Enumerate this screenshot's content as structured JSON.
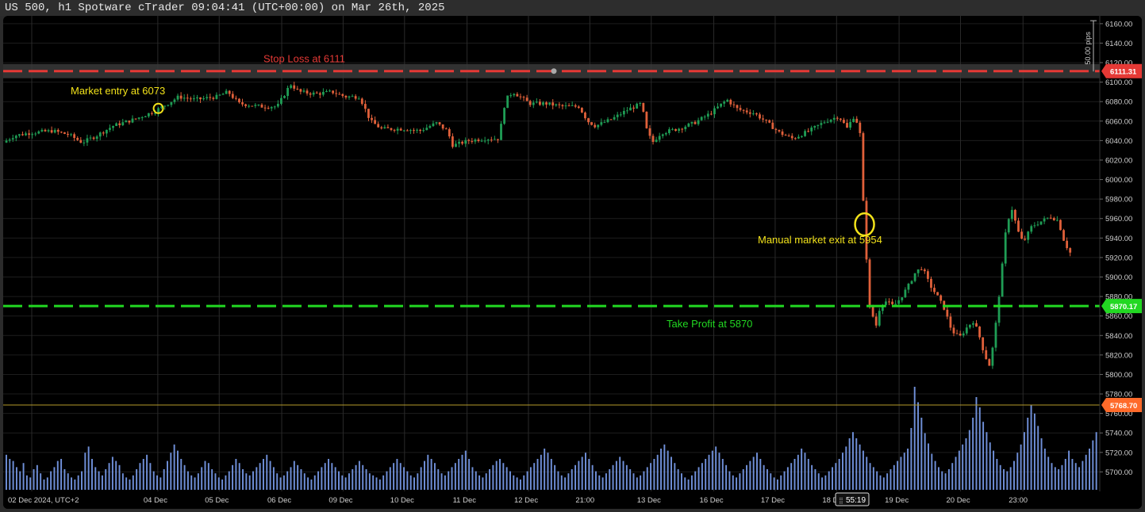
{
  "window": {
    "title": "US 500, h1 Spotware cTrader 09:04:41 (UTC+00:00) on Mar 26th, 2025"
  },
  "chart_data": {
    "type": "candlestick",
    "symbol": "US 500",
    "timeframe": "h1",
    "broker": "Spotware cTrader",
    "ylim": [
      5680,
      6168
    ],
    "y_ticks": [
      "6160.00",
      "6140.00",
      "6120.00",
      "6100.00",
      "6080.00",
      "6060.00",
      "6040.00",
      "6020.00",
      "6000.00",
      "5980.00",
      "5960.00",
      "5940.00",
      "5920.00",
      "5900.00",
      "5880.00",
      "5860.00",
      "5840.00",
      "5820.00",
      "5800.00",
      "5780.00",
      "5760.00",
      "5740.00",
      "5720.00",
      "5700.00"
    ],
    "x_labels": [
      {
        "label": "02 Dec 2024, UTC+2",
        "t": 0.0
      },
      {
        "label": "04 Dec",
        "t": 0.141
      },
      {
        "label": "05 Dec",
        "t": 0.197
      },
      {
        "label": "06 Dec",
        "t": 0.254
      },
      {
        "label": "09 Dec",
        "t": 0.31
      },
      {
        "label": "10 Dec",
        "t": 0.366
      },
      {
        "label": "11 Dec",
        "t": 0.423
      },
      {
        "label": "12 Dec",
        "t": 0.479
      },
      {
        "label": "21:00",
        "t": 0.535
      },
      {
        "label": "13 Dec",
        "t": 0.591
      },
      {
        "label": "16 Dec",
        "t": 0.648
      },
      {
        "label": "17 Dec",
        "t": 0.704
      },
      {
        "label": "18 Dec",
        "t": 0.76
      },
      {
        "label": "19 Dec",
        "t": 0.817
      },
      {
        "label": "20 Dec",
        "t": 0.873
      },
      {
        "label": "23:00",
        "t": 0.93
      }
    ],
    "time_badge": "55:19",
    "pips_label": "50.00 pips",
    "price_path": [
      [
        0.0,
        6038
      ],
      [
        0.01,
        6045
      ],
      [
        0.025,
        6048
      ],
      [
        0.045,
        6050
      ],
      [
        0.06,
        6046
      ],
      [
        0.072,
        6038
      ],
      [
        0.085,
        6045
      ],
      [
        0.1,
        6055
      ],
      [
        0.12,
        6062
      ],
      [
        0.138,
        6070
      ],
      [
        0.15,
        6078
      ],
      [
        0.16,
        6085
      ],
      [
        0.175,
        6082
      ],
      [
        0.195,
        6085
      ],
      [
        0.205,
        6090
      ],
      [
        0.215,
        6078
      ],
      [
        0.235,
        6075
      ],
      [
        0.25,
        6075
      ],
      [
        0.262,
        6098
      ],
      [
        0.27,
        6090
      ],
      [
        0.285,
        6088
      ],
      [
        0.3,
        6090
      ],
      [
        0.312,
        6085
      ],
      [
        0.325,
        6085
      ],
      [
        0.335,
        6060
      ],
      [
        0.345,
        6052
      ],
      [
        0.365,
        6052
      ],
      [
        0.38,
        6050
      ],
      [
        0.395,
        6058
      ],
      [
        0.405,
        6050
      ],
      [
        0.41,
        6035
      ],
      [
        0.425,
        6040
      ],
      [
        0.44,
        6042
      ],
      [
        0.452,
        6042
      ],
      [
        0.458,
        6082
      ],
      [
        0.465,
        6090
      ],
      [
        0.48,
        6078
      ],
      [
        0.495,
        6078
      ],
      [
        0.51,
        6075
      ],
      [
        0.525,
        6075
      ],
      [
        0.533,
        6060
      ],
      [
        0.54,
        6055
      ],
      [
        0.555,
        6062
      ],
      [
        0.57,
        6072
      ],
      [
        0.582,
        6078
      ],
      [
        0.587,
        6050
      ],
      [
        0.592,
        6038
      ],
      [
        0.6,
        6048
      ],
      [
        0.615,
        6052
      ],
      [
        0.63,
        6058
      ],
      [
        0.645,
        6068
      ],
      [
        0.66,
        6082
      ],
      [
        0.67,
        6072
      ],
      [
        0.685,
        6068
      ],
      [
        0.695,
        6060
      ],
      [
        0.708,
        6048
      ],
      [
        0.72,
        6042
      ],
      [
        0.735,
        6050
      ],
      [
        0.75,
        6060
      ],
      [
        0.762,
        6065
      ],
      [
        0.77,
        6052
      ],
      [
        0.775,
        6065
      ],
      [
        0.781,
        6055
      ],
      [
        0.785,
        5960
      ],
      [
        0.79,
        5870
      ],
      [
        0.796,
        5850
      ],
      [
        0.8,
        5872
      ],
      [
        0.805,
        5875
      ],
      [
        0.812,
        5870
      ],
      [
        0.818,
        5878
      ],
      [
        0.825,
        5890
      ],
      [
        0.832,
        5905
      ],
      [
        0.838,
        5910
      ],
      [
        0.845,
        5892
      ],
      [
        0.852,
        5880
      ],
      [
        0.858,
        5868
      ],
      [
        0.865,
        5845
      ],
      [
        0.872,
        5838
      ],
      [
        0.88,
        5850
      ],
      [
        0.885,
        5855
      ],
      [
        0.89,
        5840
      ],
      [
        0.895,
        5820
      ],
      [
        0.9,
        5808
      ],
      [
        0.905,
        5850
      ],
      [
        0.91,
        5900
      ],
      [
        0.915,
        5955
      ],
      [
        0.92,
        5970
      ],
      [
        0.925,
        5948
      ],
      [
        0.93,
        5935
      ],
      [
        0.938,
        5952
      ],
      [
        0.948,
        5958
      ],
      [
        0.955,
        5962
      ],
      [
        0.962,
        5958
      ],
      [
        0.968,
        5935
      ],
      [
        0.973,
        5925
      ]
    ],
    "volume_bars": [
      0.34,
      0.3,
      0.28,
      0.22,
      0.18,
      0.26,
      0.14,
      0.12,
      0.2,
      0.24,
      0.16,
      0.1,
      0.12,
      0.18,
      0.22,
      0.28,
      0.3,
      0.2,
      0.16,
      0.12,
      0.1,
      0.14,
      0.18,
      0.36,
      0.42,
      0.3,
      0.22,
      0.18,
      0.14,
      0.2,
      0.26,
      0.32,
      0.28,
      0.24,
      0.16,
      0.12,
      0.1,
      0.14,
      0.2,
      0.26,
      0.3,
      0.34,
      0.26,
      0.18,
      0.14,
      0.12,
      0.2,
      0.28,
      0.36,
      0.44,
      0.38,
      0.3,
      0.24,
      0.18,
      0.14,
      0.12,
      0.16,
      0.22,
      0.28,
      0.26,
      0.2,
      0.16,
      0.12,
      0.1,
      0.14,
      0.18,
      0.24,
      0.3,
      0.26,
      0.2,
      0.16,
      0.14,
      0.18,
      0.22,
      0.26,
      0.3,
      0.34,
      0.28,
      0.22,
      0.16,
      0.12,
      0.14,
      0.18,
      0.22,
      0.28,
      0.24,
      0.2,
      0.16,
      0.12,
      0.1,
      0.14,
      0.18,
      0.22,
      0.26,
      0.3,
      0.26,
      0.22,
      0.18,
      0.14,
      0.12,
      0.16,
      0.2,
      0.24,
      0.28,
      0.24,
      0.2,
      0.16,
      0.14,
      0.12,
      0.1,
      0.14,
      0.18,
      0.22,
      0.26,
      0.3,
      0.26,
      0.22,
      0.18,
      0.14,
      0.12,
      0.16,
      0.22,
      0.28,
      0.34,
      0.3,
      0.26,
      0.2,
      0.16,
      0.14,
      0.18,
      0.22,
      0.26,
      0.3,
      0.34,
      0.38,
      0.3,
      0.22,
      0.18,
      0.14,
      0.12,
      0.16,
      0.2,
      0.24,
      0.28,
      0.3,
      0.26,
      0.22,
      0.18,
      0.14,
      0.12,
      0.1,
      0.14,
      0.18,
      0.22,
      0.26,
      0.3,
      0.34,
      0.4,
      0.36,
      0.3,
      0.24,
      0.18,
      0.14,
      0.12,
      0.16,
      0.2,
      0.24,
      0.28,
      0.32,
      0.36,
      0.3,
      0.24,
      0.18,
      0.14,
      0.12,
      0.16,
      0.2,
      0.24,
      0.28,
      0.32,
      0.28,
      0.24,
      0.2,
      0.16,
      0.12,
      0.14,
      0.18,
      0.22,
      0.26,
      0.3,
      0.34,
      0.4,
      0.44,
      0.38,
      0.32,
      0.26,
      0.2,
      0.16,
      0.12,
      0.1,
      0.14,
      0.18,
      0.22,
      0.26,
      0.3,
      0.34,
      0.38,
      0.42,
      0.36,
      0.3,
      0.24,
      0.18,
      0.14,
      0.12,
      0.16,
      0.2,
      0.24,
      0.28,
      0.32,
      0.36,
      0.3,
      0.24,
      0.2,
      0.16,
      0.12,
      0.1,
      0.14,
      0.18,
      0.22,
      0.26,
      0.3,
      0.34,
      0.4,
      0.36,
      0.3,
      0.24,
      0.2,
      0.16,
      0.12,
      0.14,
      0.18,
      0.22,
      0.26,
      0.3,
      0.36,
      0.42,
      0.5,
      0.56,
      0.5,
      0.44,
      0.38,
      0.32,
      0.26,
      0.22,
      0.18,
      0.14,
      0.12,
      0.16,
      0.2,
      0.24,
      0.28,
      0.32,
      0.36,
      0.4,
      0.6,
      1.0,
      0.85,
      0.7,
      0.55,
      0.45,
      0.35,
      0.28,
      0.22,
      0.18,
      0.16,
      0.2,
      0.26,
      0.32,
      0.38,
      0.44,
      0.5,
      0.58,
      0.7,
      0.9,
      0.8,
      0.66,
      0.56,
      0.46,
      0.38,
      0.3,
      0.24,
      0.2,
      0.18,
      0.22,
      0.28,
      0.36,
      0.44,
      0.56,
      0.7,
      0.82,
      0.74,
      0.62,
      0.5,
      0.4,
      0.32,
      0.26,
      0.22,
      0.2,
      0.24,
      0.3,
      0.38,
      0.3,
      0.26,
      0.22,
      0.28,
      0.34,
      0.4,
      0.48,
      0.56
    ],
    "levels": [
      {
        "name": "stop-loss",
        "price": 6111.31,
        "label": "Stop Loss at 6111",
        "badge": "6111.31",
        "color": "#e53935"
      },
      {
        "name": "take-profit",
        "price": 5870.17,
        "label": "Take Profit at 5870",
        "badge": "5870.17",
        "color": "#22d822"
      },
      {
        "name": "current-price",
        "price": 5768.7,
        "badge": "5768.70",
        "color": "#ff6a2a"
      }
    ],
    "annotations": [
      {
        "name": "market-entry",
        "label": "Market entry at 6073",
        "color": "#f2e21a"
      },
      {
        "name": "market-exit",
        "label": "Manual market exit at 5954",
        "color": "#f2e21a"
      }
    ],
    "colors": {
      "up": "#1f9d55",
      "down": "#e0603a",
      "volume": "#6f8fd8",
      "grid": "#1d1d1d"
    }
  }
}
